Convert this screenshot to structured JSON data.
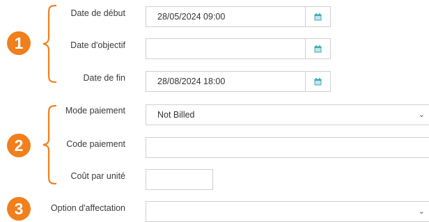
{
  "badges": {
    "one": "1",
    "two": "2",
    "three": "3"
  },
  "dates": {
    "start_label": "Date de début",
    "start_value": "28/05/2024 09:00",
    "goal_label": "Date d'objectif",
    "goal_value": "",
    "end_label": "Date de fin",
    "end_value": "28/08/2024 18:00",
    "calendar_icon": "calendar-icon"
  },
  "payment": {
    "mode_label": "Mode paiement",
    "mode_value": "Not Billed",
    "code_label": "Code paiement",
    "code_value": "",
    "unit_cost_label": "Coût par unité",
    "unit_cost_value": ""
  },
  "assignment": {
    "option_label": "Option d'affectation",
    "option_value": ""
  },
  "colors": {
    "accent_orange": "#f07f1c",
    "calendar_teal": "#3aa9b5",
    "border": "#cfcfcf"
  }
}
